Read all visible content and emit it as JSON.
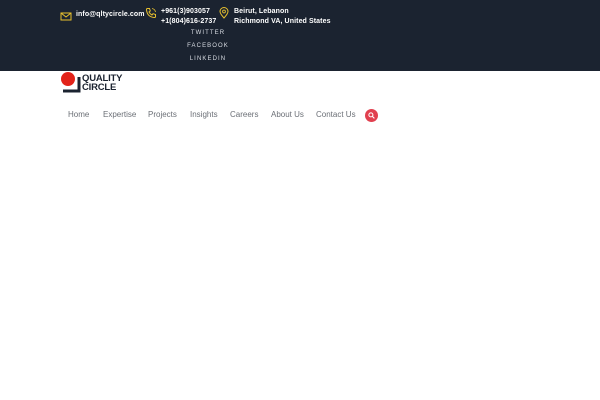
{
  "topbar": {
    "email": "info@qltycircle.com",
    "phones": [
      "+961(3)903057",
      "+1(804)616-2737"
    ],
    "addresses": [
      "Beirut, Lebanon",
      "Richmond VA, United States"
    ],
    "social": [
      "TWITTER",
      "FACEBOOK",
      "LINKEDIN"
    ]
  },
  "logo": {
    "line1": "QUALITY",
    "line2": "CIRCLE",
    "colors": {
      "red": "#e2231a",
      "dark": "#1b2330"
    }
  },
  "nav": {
    "items": [
      "Home",
      "Expertise",
      "Projects",
      "Insights",
      "Careers",
      "About Us",
      "Contact Us"
    ],
    "search_icon": "search-icon"
  },
  "colors": {
    "topbar_bg": "#1b2330",
    "accent": "#e1404f",
    "icon_yellow": "#e8c12e",
    "nav_text": "#6b6f76"
  }
}
